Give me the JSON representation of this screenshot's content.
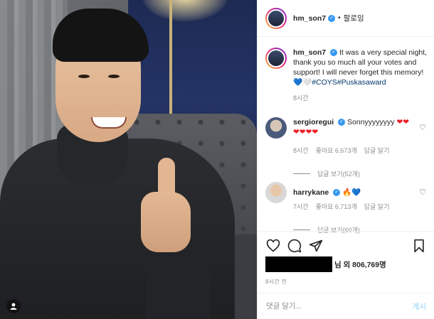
{
  "header": {
    "username": "hm_son7",
    "verified_glyph": "✓",
    "separator": "•",
    "follow_label": "팔로잉"
  },
  "caption": {
    "username": "hm_son7",
    "text": "It was a very special night, thank you so much all your votes and support! I will never forget this memory!",
    "emoji": "💙🤍",
    "hashtags": "#COYS#Puskasaward",
    "time": "8시간"
  },
  "comments": [
    {
      "username": "sergioregui",
      "text": "Sonnyyyyyyyy",
      "emoji": "❤❤",
      "emoji_line2": "❤❤❤❤",
      "time": "8시간",
      "likes": "좋아요 6,673개",
      "reply_label": "답글 달기",
      "view_replies": "답글 보기(52개)"
    },
    {
      "username": "harrykane",
      "text": "",
      "emoji": "🔥💙",
      "time": "7시간",
      "likes": "좋아요 6,713개",
      "reply_label": "답글 달기",
      "view_replies": "답글 보기(60개)"
    }
  ],
  "likes": {
    "suffix": "님 외 806,769명"
  },
  "post_time": "8시간 전",
  "add_comment": {
    "placeholder": "댓글 달기...",
    "post_label": "게시"
  },
  "icons": {
    "like": "heart-icon",
    "comment": "comment-icon",
    "share": "share-icon",
    "save": "bookmark-icon",
    "tagged": "user-tag-icon"
  },
  "colors": {
    "verified": "#3897f0",
    "hashtag": "#00376b",
    "meta": "#8e8e8e",
    "post_disabled": "#b2dffc"
  }
}
